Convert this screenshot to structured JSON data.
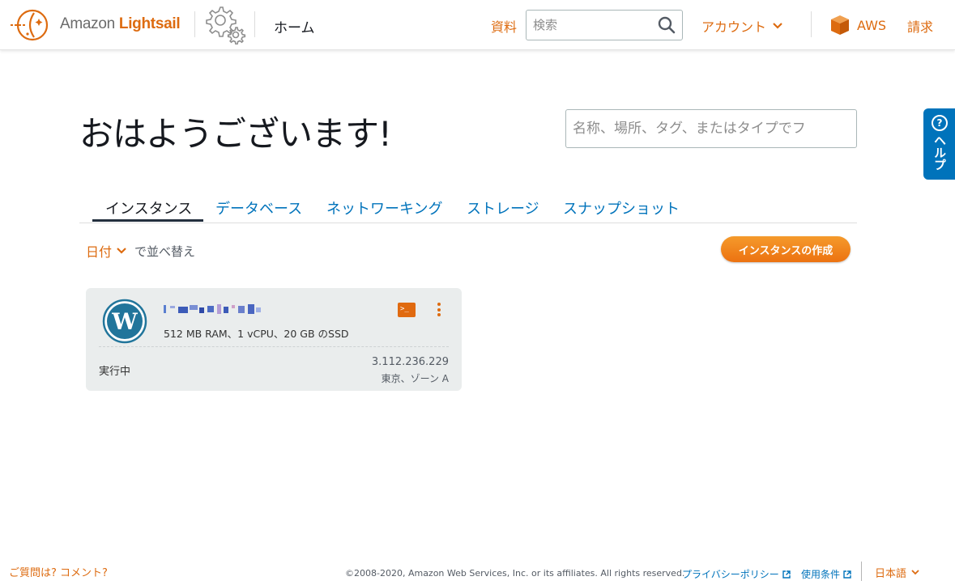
{
  "header": {
    "brand_prefix": "Amazon",
    "brand_name": "Lightsail",
    "home_label": "ホーム",
    "docs_label": "資料",
    "search_placeholder": "検索",
    "account_label": "アカウント",
    "aws_label": "AWS",
    "billing_label": "請求"
  },
  "help": {
    "label": "ヘルプ",
    "icon": "question-circle-icon"
  },
  "main": {
    "greeting": "おはようございます!",
    "filter_placeholder": "名称、場所、タグ、またはタイプでフ",
    "tabs": [
      {
        "label": "インスタンス",
        "active": true
      },
      {
        "label": "データベース",
        "active": false
      },
      {
        "label": "ネットワーキング",
        "active": false
      },
      {
        "label": "ストレージ",
        "active": false
      },
      {
        "label": "スナップショット",
        "active": false
      }
    ],
    "sort": {
      "value": "日付",
      "label": "で並べ替え"
    },
    "create_button": "インスタンスの作成"
  },
  "instance": {
    "spec": "512 MB RAM、1 vCPU、20 GB のSSD",
    "status": "実行中",
    "ip": "3.112.236.229",
    "zone": "東京、ゾーン A",
    "blueprint_icon": "wordpress-icon"
  },
  "footer": {
    "feedback": "ご質問は? コメント?",
    "copyright": "©2008-2020, Amazon Web Services, Inc. or its affiliates. All rights reserved.",
    "privacy": "プライバシーポリシー",
    "terms": "使用条件",
    "language": "日本語"
  },
  "colors": {
    "accent": "#dd6b10",
    "link": "#0073bb",
    "help_tab": "#0073bb",
    "card_bg": "#eaeded"
  }
}
